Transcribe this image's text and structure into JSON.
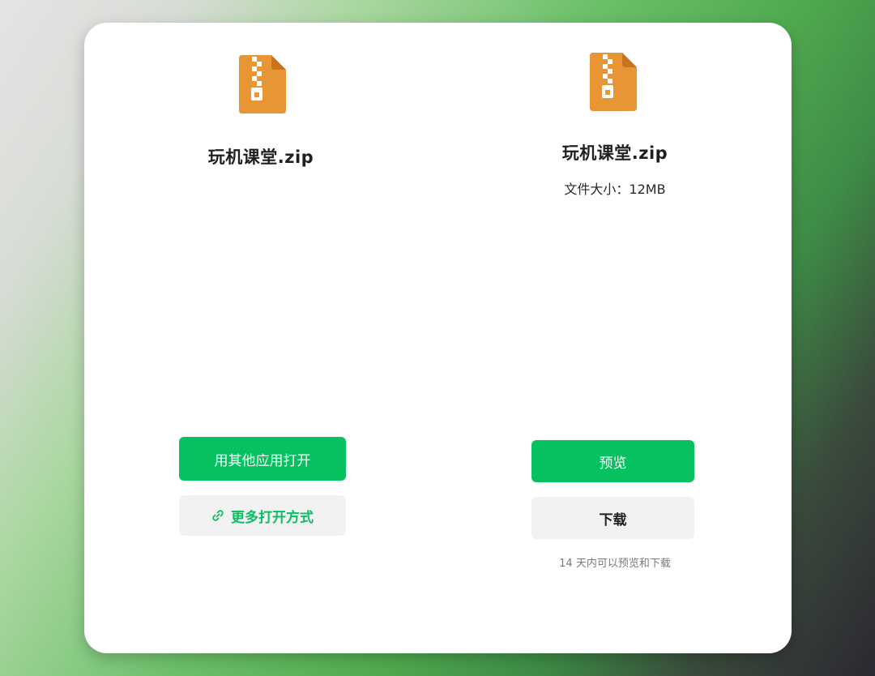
{
  "left_panel": {
    "file_icon": "zip-file-icon",
    "file_name": "玩机课堂.zip",
    "open_with_other_app_label": "用其他应用打开",
    "more_open_methods_icon": "link-icon",
    "more_open_methods_label": "更多打开方式"
  },
  "right_panel": {
    "file_icon": "zip-file-icon",
    "file_name": "玩机课堂.zip",
    "file_size": "文件大小：12MB",
    "preview_label": "预览",
    "download_label": "下载",
    "hint": "14 天内可以预览和下载"
  },
  "colors": {
    "accent_green": "#07c160",
    "zip_orange": "#e89536",
    "secondary_button_bg": "#f2f2f2"
  }
}
